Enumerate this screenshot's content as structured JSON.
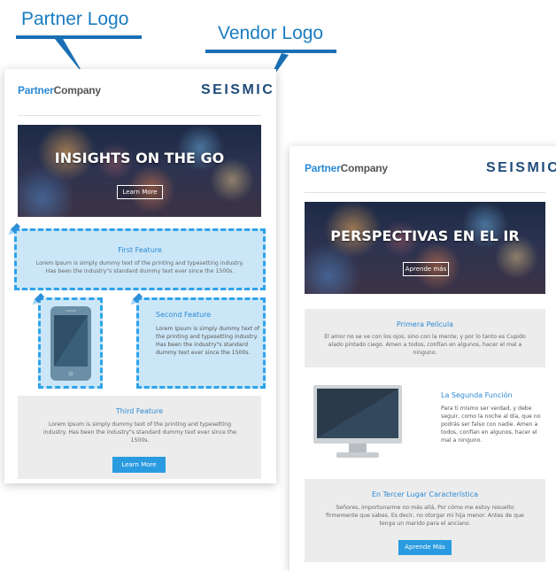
{
  "callouts": {
    "partner": "Partner Logo",
    "vendor": "Vendor Logo"
  },
  "colors": {
    "accent": "#2a9be0",
    "highlight_fill": "#cbe6f7",
    "highlight_border": "#2ea3ea",
    "vendor_logo": "#1f4c7a"
  },
  "english_card": {
    "partner_logo": {
      "part1": "Partner",
      "part2": "Company"
    },
    "vendor_logo": "SEISMIC",
    "hero": {
      "title": "INSIGHTS ON THE GO",
      "button": "Learn More"
    },
    "feature1": {
      "title": "First Feature",
      "text": "Lorem Ipsum is simply dummy text of the printing and typesetting industry. Has been the industry\"s standard dummy text ever since the 1500s."
    },
    "feature2": {
      "title": "Second Feature",
      "text": "Lorem Ipsum is simply dummy text of the printing and typesetting industry. Has been the industry\"s standard dummy text ever since the 1500s.",
      "image_icon": "smartphone-icon"
    },
    "feature3": {
      "title": "Third Feature",
      "text": "Lorem Ipsum is simply dummy text of the printing and typesetting industry. Has been the industry\"s standard dummy text ever since the 1500s.",
      "button": "Learn More"
    },
    "edit_icon": "pencil-icon"
  },
  "spanish_card": {
    "partner_logo": {
      "part1": "Partner",
      "part2": "Company"
    },
    "vendor_logo": "SEISMIC",
    "hero": {
      "title": "PERSPECTIVAS EN EL IR",
      "button": "Aprende más"
    },
    "feature1": {
      "title": "Primera Película",
      "text": "El amor no se ve con los ojos, sino con la mente; y por lo tanto es Cupido alado pintado ciego. Amen a todos, confían en algunos, hacer el mal a ninguno."
    },
    "feature2": {
      "title": "La Segunda Función",
      "text": "Para ti mismo ser verdad, y debe seguir, como la noche al día, que no podrás ser falso con nadie. Amen a todos, confían en algunos, hacer el mal a ninguno.",
      "image_icon": "monitor-icon"
    },
    "feature3": {
      "title": "En Tercer Lugar Característica",
      "text": "Señores, importunarme no más allá, Por cómo me estoy resuelto firmemente que sabes. Es decir, no otorgar mi hija menor. Antes de que tenga un marido para el anciano.",
      "button": "Aprende Más"
    }
  }
}
